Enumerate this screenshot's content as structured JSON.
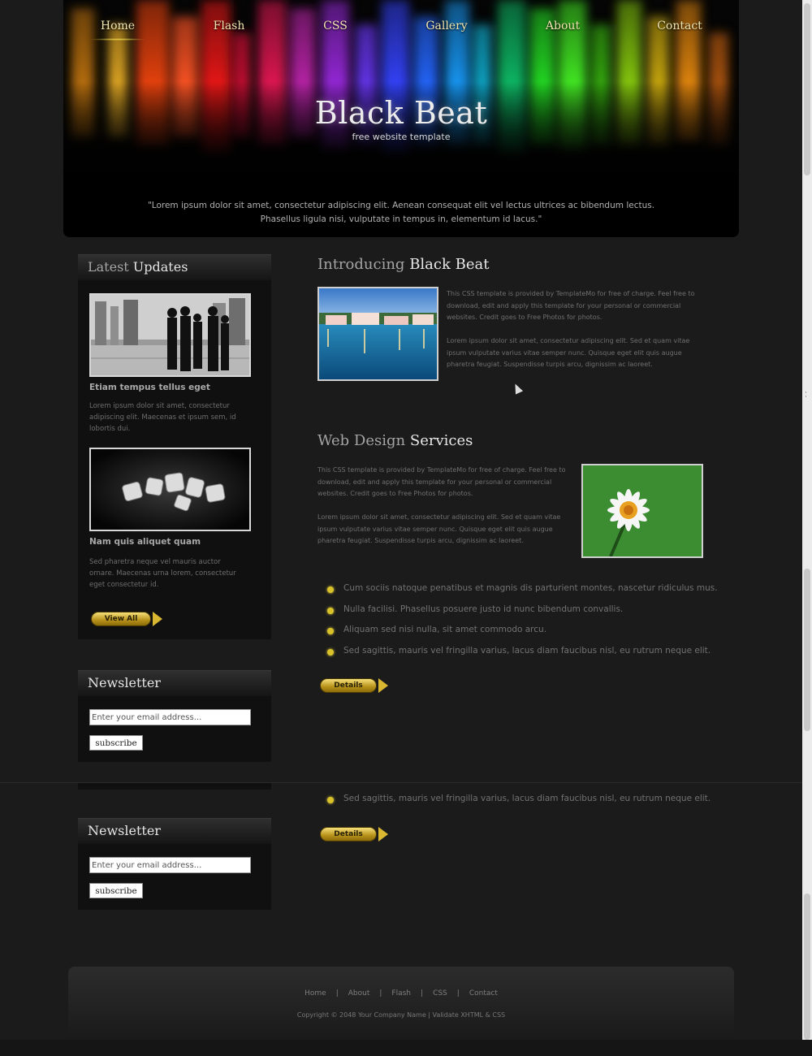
{
  "nav": {
    "items": [
      "Home",
      "Flash",
      "CSS",
      "Gallery",
      "About",
      "Contact"
    ],
    "active": "Home"
  },
  "header": {
    "title": "Black Beat",
    "subtitle": "free website template",
    "quote_line1": "\"Lorem ipsum dolor sit amet, consectetur adipiscing elit. Aenean consequat elit vel lectus ultrices ac bibendum lectus.",
    "quote_line2": "Phasellus ligula nisi, vulputate in tempus in, elementum id lacus.\""
  },
  "sidebar": {
    "updates": {
      "title_light": "Latest",
      "title_strong": "Updates",
      "posts": [
        {
          "title": "Etiam tempus tellus eget",
          "text": "Lorem ipsum dolor sit amet, consectetur adipiscing elit. Maecenas et ipsum sem, id lobortis dui."
        },
        {
          "title": "Nam quis aliquet quam",
          "text": "Sed pharetra neque vel mauris auctor ornare. Maecenas urna lorem, consectetur eget consectetur id."
        }
      ],
      "view_all": "View All"
    },
    "newsletter": {
      "title": "Newsletter",
      "placeholder": "Enter your email address...",
      "button": "subscribe"
    }
  },
  "main": {
    "intro": {
      "title_light": "Introducing",
      "title_strong": "Black Beat",
      "p1": "This CSS template is provided by TemplateMo for free of charge. Feel free to download, edit and apply this template for your personal or commercial websites. Credit goes to Free Photos for photos.",
      "p2": "Lorem ipsum dolor sit amet, consectetur adipiscing elit. Sed et quam vitae ipsum vulputate varius vitae semper nunc. Quisque eget elit quis augue pharetra feugiat. Suspendisse turpis arcu, dignissim ac laoreet."
    },
    "services": {
      "title_light": "Web Design",
      "title_strong": "Services",
      "p1": "This CSS template is provided by TemplateMo for free of charge. Feel free to download, edit and apply this template for your personal or commercial websites. Credit goes to Free Photos for photos.",
      "p2": "Lorem ipsum dolor sit amet, consectetur adipiscing elit. Sed et quam vitae ipsum vulputate varius vitae semper nunc. Quisque eget elit quis augue pharetra feugiat. Suspendisse turpis arcu, dignissim ac laoreet.",
      "bullets": [
        "Cum sociis natoque penatibus et magnis dis parturient montes, nascetur ridiculus mus.",
        "Nulla facilisi. Phasellus posuere justo id nunc bibendum convallis.",
        "Aliquam sed nisi nulla, sit amet commodo arcu.",
        "Sed sagittis, mauris vel fringilla varius, lacus diam faucibus nisl, eu rutrum neque elit."
      ],
      "details": "Details"
    },
    "repeat_bullet": "Sed sagittis, mauris vel fringilla varius, lacus diam faucibus nisl, eu rutrum neque elit."
  },
  "footer": {
    "links": [
      "Home",
      "About",
      "Flash",
      "CSS",
      "Contact"
    ],
    "copyright": "Copyright © 2048 Your Company Name | Validate XHTML & CSS"
  },
  "colors": {
    "background": "#1b1b1b",
    "nav_text": "#f0e6b0",
    "accent_gold": "#d9c22a"
  }
}
